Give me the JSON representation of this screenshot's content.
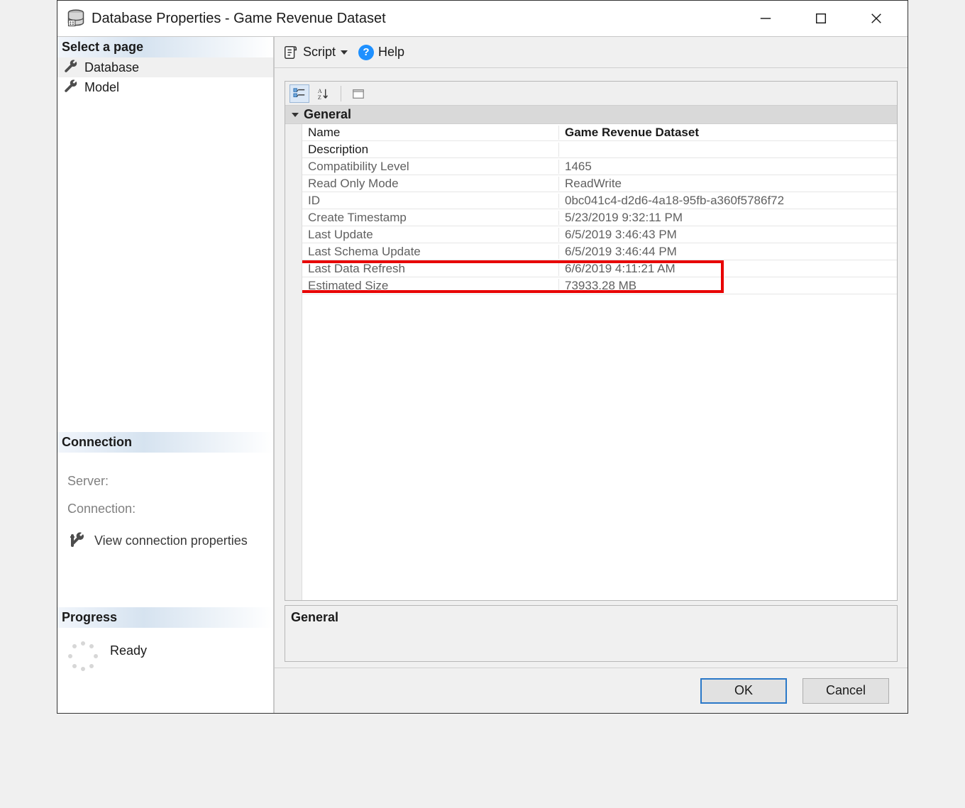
{
  "window": {
    "title": "Database Properties - Game Revenue Dataset"
  },
  "sidebar": {
    "select_page": "Select a page",
    "pages": [
      {
        "label": "Database",
        "selected": true
      },
      {
        "label": "Model",
        "selected": false
      }
    ],
    "connection_header": "Connection",
    "server_label": "Server:",
    "connection_label": "Connection:",
    "view_conn_props": "View connection properties",
    "progress_header": "Progress",
    "progress_status": "Ready"
  },
  "toolbar": {
    "script": "Script",
    "help": "Help"
  },
  "propgrid": {
    "category": "General",
    "rows": [
      {
        "label": "Name",
        "value": "Game Revenue Dataset",
        "readonly": false,
        "bold": true
      },
      {
        "label": "Description",
        "value": "",
        "readonly": false,
        "bold": false
      },
      {
        "label": "Compatibility Level",
        "value": "1465",
        "readonly": true,
        "bold": false
      },
      {
        "label": "Read Only Mode",
        "value": "ReadWrite",
        "readonly": true,
        "bold": false
      },
      {
        "label": "ID",
        "value": "0bc041c4-d2d6-4a18-95fb-a360f5786f72",
        "readonly": true,
        "bold": false
      },
      {
        "label": "Create Timestamp",
        "value": "5/23/2019 9:32:11 PM",
        "readonly": true,
        "bold": false
      },
      {
        "label": "Last Update",
        "value": "6/5/2019 3:46:43 PM",
        "readonly": true,
        "bold": false
      },
      {
        "label": "Last Schema Update",
        "value": "6/5/2019 3:46:44 PM",
        "readonly": true,
        "bold": false
      },
      {
        "label": "Last Data Refresh",
        "value": "6/6/2019 4:11:21 AM",
        "readonly": true,
        "bold": false
      },
      {
        "label": "Estimated Size",
        "value": "73933.28 MB",
        "readonly": true,
        "bold": false
      }
    ],
    "description_title": "General"
  },
  "footer": {
    "ok": "OK",
    "cancel": "Cancel"
  }
}
